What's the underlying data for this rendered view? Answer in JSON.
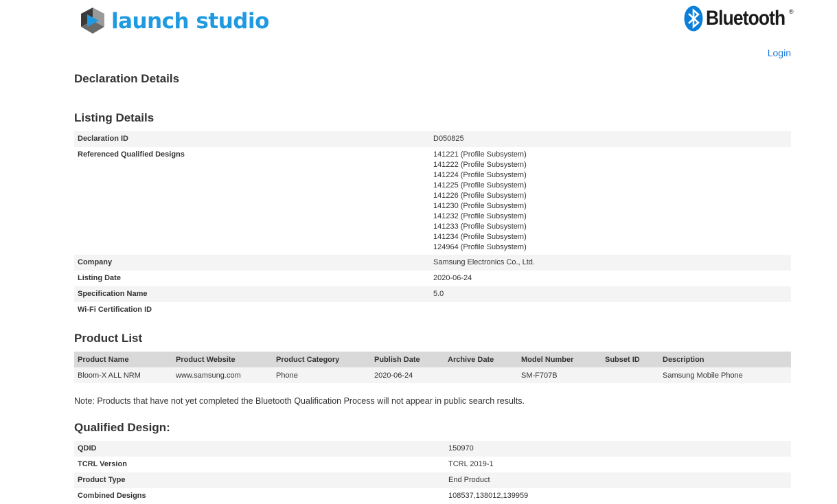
{
  "header": {
    "brand_left": "launch studio",
    "brand_right": "Bluetooth",
    "brand_right_reg": "®",
    "login_label": "Login"
  },
  "page_title": "Declaration Details",
  "listing": {
    "title": "Listing Details",
    "declaration_id_label": "Declaration ID",
    "declaration_id": "D050825",
    "ref_designs_label": "Referenced Qualified Designs",
    "ref_designs": [
      "141221 (Profile Subsystem)",
      "141222 (Profile Subsystem)",
      "141224 (Profile Subsystem)",
      "141225 (Profile Subsystem)",
      "141226 (Profile Subsystem)",
      "141230 (Profile Subsystem)",
      "141232 (Profile Subsystem)",
      "141233 (Profile Subsystem)",
      "141234 (Profile Subsystem)",
      "124964 (Profile Subsystem)"
    ],
    "company_label": "Company",
    "company": "Samsung Electronics Co., Ltd.",
    "listing_date_label": "Listing Date",
    "listing_date": "2020-06-24",
    "spec_name_label": "Specification Name",
    "spec_name": "5.0",
    "wifi_label": "Wi-Fi Certification ID",
    "wifi": ""
  },
  "product_list": {
    "title": "Product List",
    "columns": [
      "Product Name",
      "Product Website",
      "Product Category",
      "Publish Date",
      "Archive Date",
      "Model Number",
      "Subset ID",
      "Description"
    ],
    "rows": [
      [
        "Bloom-X ALL NRM",
        "www.samsung.com",
        "Phone",
        "2020-06-24",
        "",
        "SM-F707B",
        "",
        "Samsung Mobile Phone"
      ]
    ],
    "note": "Note: Products that have not yet completed the Bluetooth Qualification Process will not appear in public search results."
  },
  "qualified_design": {
    "title": "Qualified Design:",
    "qdid_label": "QDID",
    "qdid": "150970",
    "tcrl_label": "TCRL Version",
    "tcrl": "TCRL 2019-1",
    "product_type_label": "Product Type",
    "product_type": "End Product",
    "combined_label": "Combined Designs",
    "combined": "108537,138012,139959"
  },
  "colors": {
    "brand_blue": "#1f9ae0",
    "link_blue": "#1a7ad6",
    "bluetooth_blue": "#0a7ed8",
    "row_alt": "#f4f4f4",
    "table_header": "#d9d9d9"
  },
  "icons": {
    "launch_logo": "launch-studio-cube-icon",
    "bluetooth_logo": "bluetooth-rune-icon"
  }
}
